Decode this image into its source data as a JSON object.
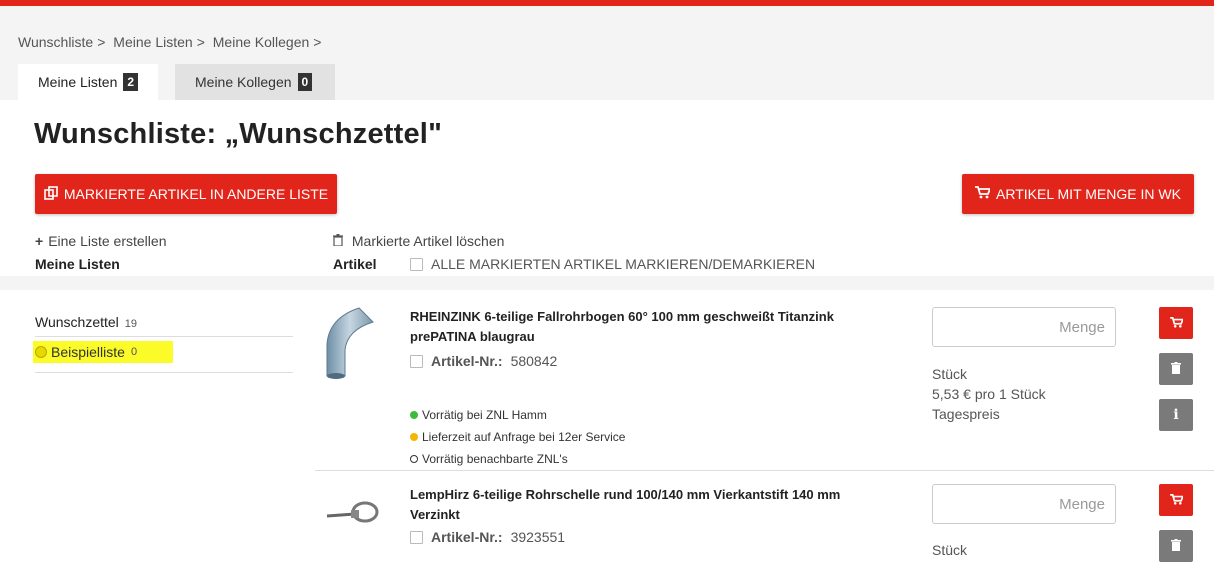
{
  "breadcrumb": [
    "Wunschliste",
    "Meine Listen",
    "Meine Kollegen"
  ],
  "breadcrumb_sep": ">",
  "tabs": [
    {
      "label": "Meine Listen",
      "count": "2"
    },
    {
      "label": "Meine Kollegen",
      "count": "0"
    }
  ],
  "title": "Wunschliste: „Wunschzettel\"",
  "buttons": {
    "move_marked": "MARKIERTE ARTIKEL IN ANDERE LISTE",
    "add_to_cart": "ARTIKEL MIT MENGE IN WK"
  },
  "actions": {
    "create_list": "Eine Liste erstellen",
    "delete_marked": "Markierte Artikel löschen"
  },
  "headers": {
    "lists": "Meine Listen",
    "articles": "Artikel",
    "mark_all": "ALLE MARKIERTEN ARTIKEL MARKIEREN/DEMARKIEREN"
  },
  "sidebar": {
    "items": [
      {
        "label": "Wunschzettel",
        "count": "19"
      },
      {
        "label": "Beispielliste",
        "count": "0"
      }
    ]
  },
  "articles": [
    {
      "name": "RHEINZINK 6-teilige Fallrohrbogen 60° 100 mm geschweißt Titanzink prePATINA blaugrau",
      "nr_label": "Artikel-Nr.:",
      "nr": "580842",
      "availability": [
        {
          "text": "Vorrätig bei ZNL Hamm",
          "color": "#3db93d"
        },
        {
          "text": "Lieferzeit auf Anfrage bei 12er Service",
          "color": "#f5b500"
        },
        {
          "text": "Vorrätig benachbarte ZNL's",
          "color": "outline"
        }
      ],
      "qty_placeholder": "Menge",
      "unit": "Stück",
      "price": "5,53 € pro  1  Stück",
      "price_note": "Tagespreis"
    },
    {
      "name": "LempHirz 6-teilige Rohrschelle rund 100/140 mm Vierkantstift 140 mm Verzinkt",
      "nr_label": "Artikel-Nr.:",
      "nr": "3923551",
      "qty_placeholder": "Menge",
      "unit": "Stück"
    }
  ],
  "colors": {
    "accent": "#e1251b",
    "highlight": "#fbfb2a"
  }
}
